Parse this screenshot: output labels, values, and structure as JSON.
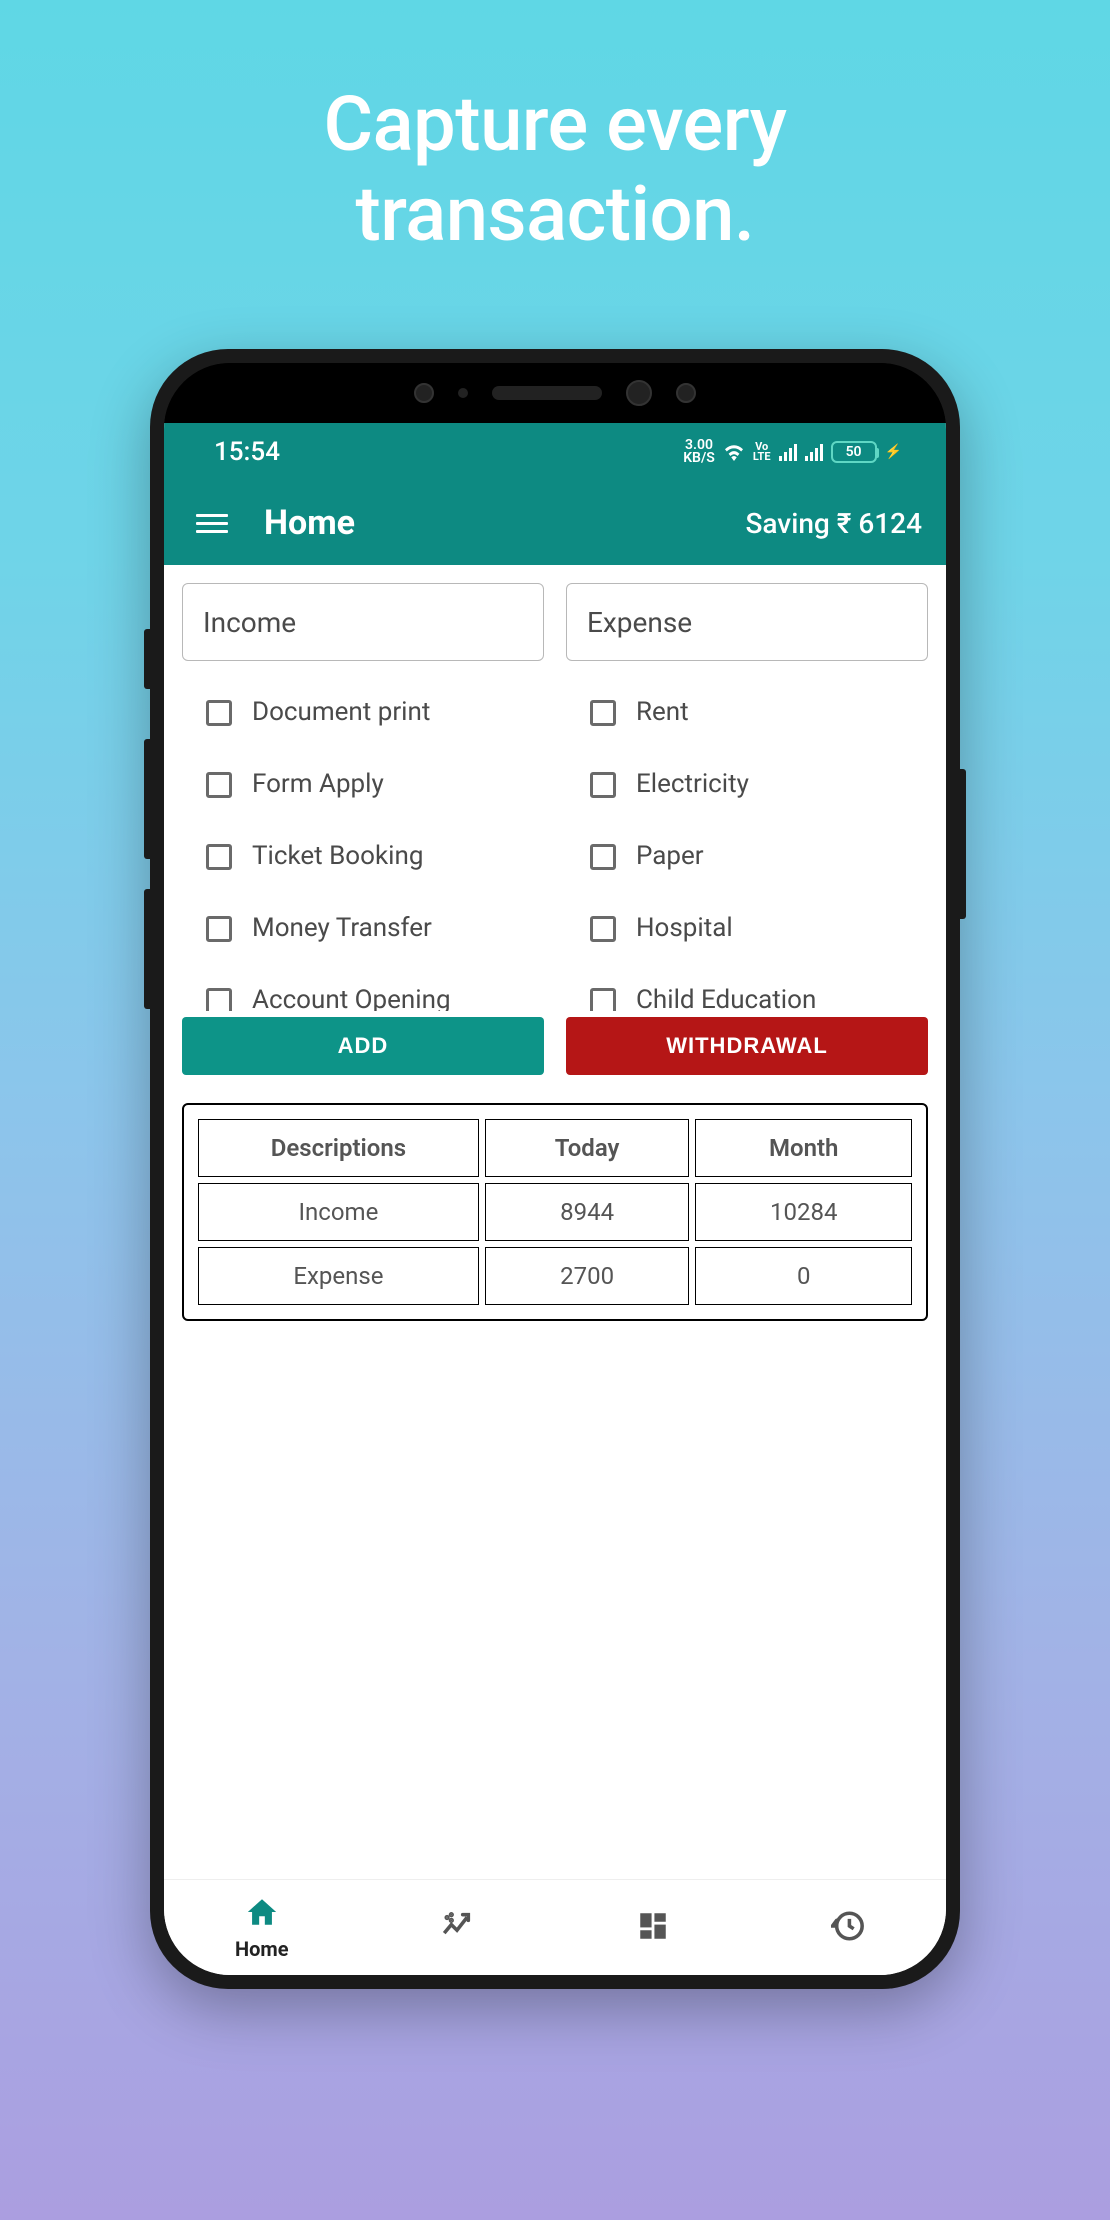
{
  "tagline": "Capture every\ntransaction.",
  "status": {
    "time": "15:54",
    "kbs_top": "3.00",
    "kbs_bottom": "KB/S",
    "lte": "VoLTE",
    "battery": "50"
  },
  "appbar": {
    "title": "Home",
    "saving": "Saving ₹ 6124"
  },
  "columns": {
    "income": {
      "label": "Income",
      "items": [
        "Document print",
        "Form Apply",
        "Ticket Booking",
        "Money Transfer",
        "Account Opening"
      ]
    },
    "expense": {
      "label": "Expense",
      "items": [
        "Rent",
        "Electricity",
        "Paper",
        "Hospital",
        "Child Education"
      ]
    }
  },
  "buttons": {
    "add": "ADD",
    "withdrawal": "WITHDRAWAL"
  },
  "summary": {
    "headers": [
      "Descriptions",
      "Today",
      "Month"
    ],
    "rows": [
      [
        "Income",
        "8944",
        "10284"
      ],
      [
        "Expense",
        "2700",
        "0"
      ]
    ]
  },
  "nav": {
    "home": "Home"
  }
}
